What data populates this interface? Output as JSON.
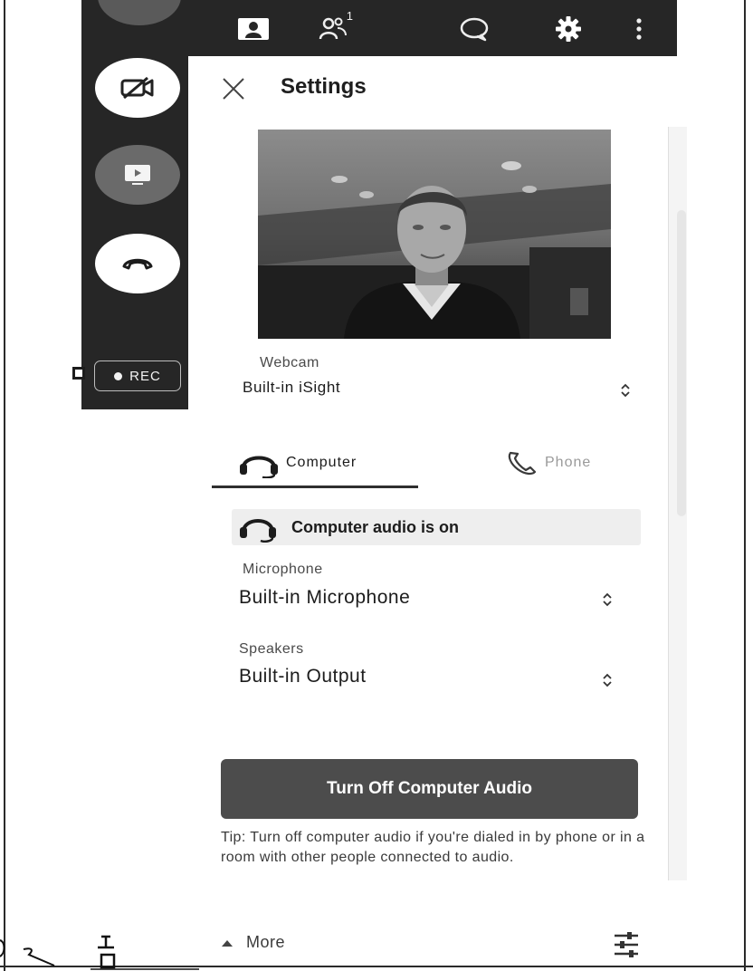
{
  "toolbar": {
    "participants_count": "1",
    "icons": [
      "person-icon",
      "participants-icon",
      "chat-icon",
      "gear-icon",
      "more-vertical-icon"
    ]
  },
  "controls": {
    "video_off_icon": "video-off-icon",
    "share_icon": "share-screen-icon",
    "hangup_icon": "hangup-icon",
    "record_label": "REC"
  },
  "settings": {
    "title": "Settings",
    "close_icon": "close-icon",
    "webcam": {
      "label": "Webcam",
      "value": "Built-in iSight"
    },
    "tabs": [
      {
        "label": "Computer",
        "icon": "headset-icon",
        "active": true
      },
      {
        "label": "Phone",
        "icon": "phone-icon",
        "active": false
      }
    ],
    "audio_status": "Computer audio is on",
    "microphone": {
      "label": "Microphone",
      "value": "Built-in Microphone"
    },
    "speakers": {
      "label": "Speakers",
      "value": "Built-in Output"
    },
    "primary_button": "Turn Off Computer Audio",
    "tip": "Tip: Turn off computer audio if you're dialed in by phone or in a room with other people connected to audio.",
    "more_label": "More",
    "filter_icon": "sliders-icon"
  },
  "colors": {
    "dark_bar": "#262626",
    "primary_button": "#4c4c4c",
    "status_bg": "#eeeeee"
  }
}
